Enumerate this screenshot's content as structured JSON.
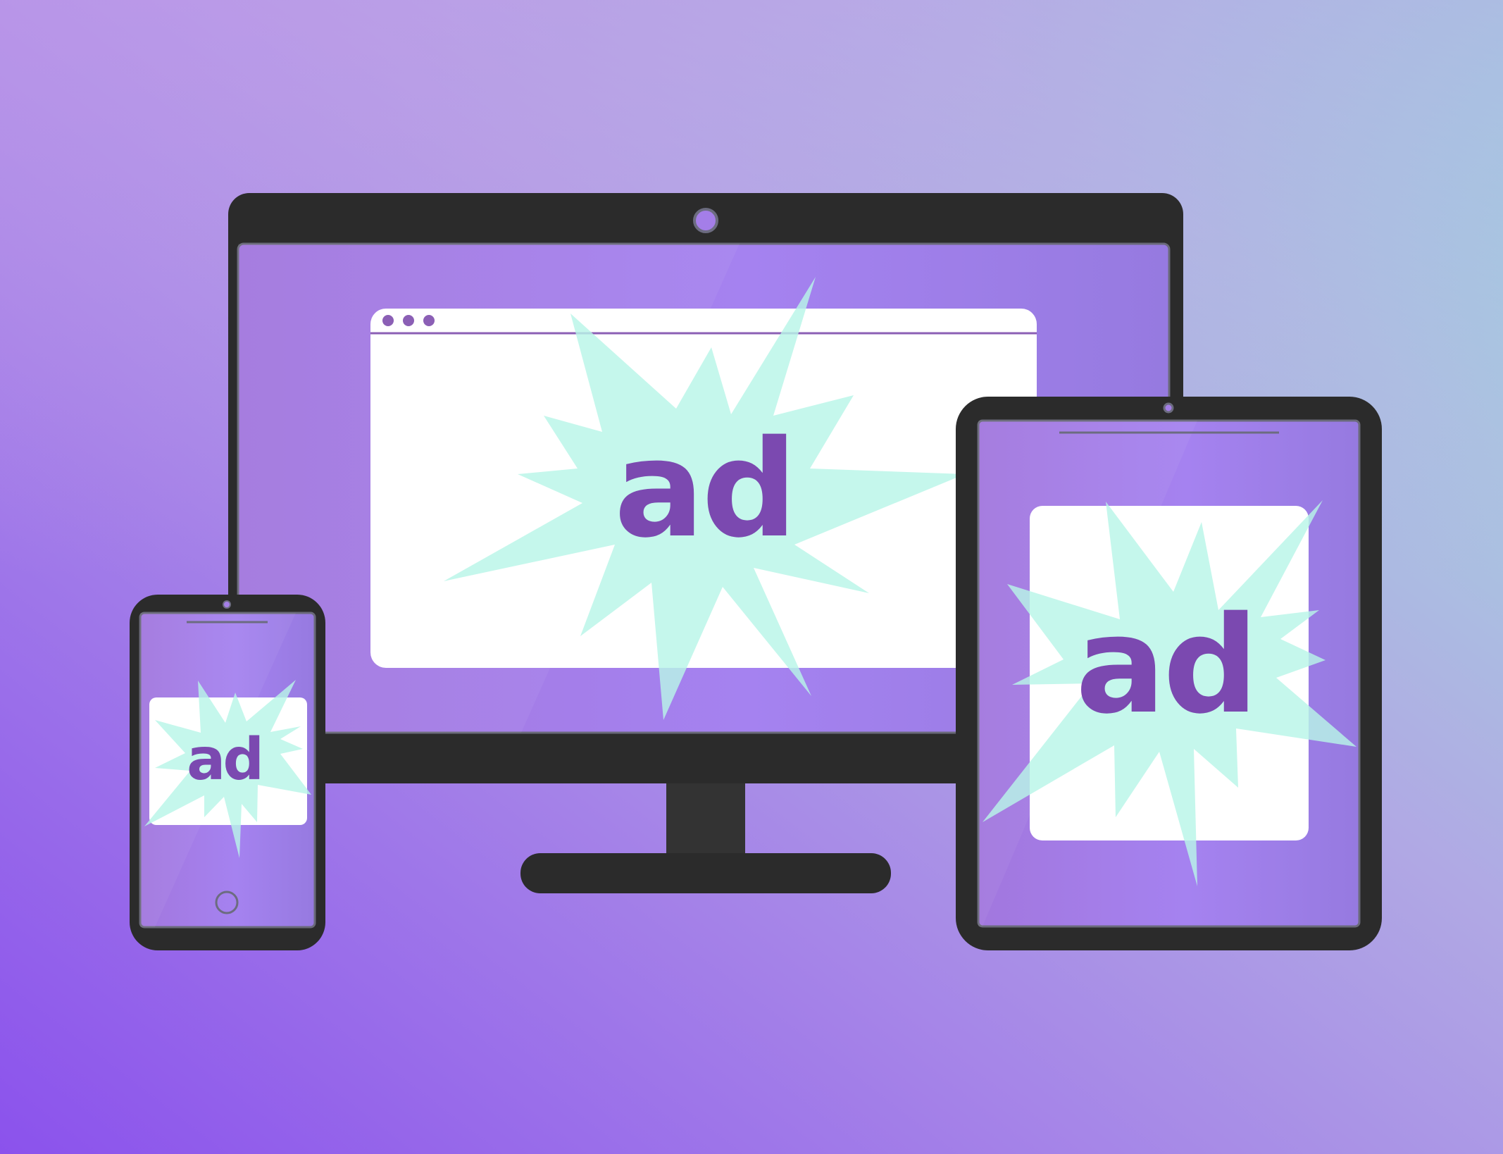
{
  "ads": {
    "monitor_label": "ad",
    "tablet_label": "ad",
    "phone_label": "ad"
  },
  "colors": {
    "background_start": "#8d55ea",
    "background_mid": "#bd94ea",
    "background_end": "#8ff1d9",
    "device_frame": "#2b2b2b",
    "screen": "#a47ee8",
    "ad_window": "#ffffff",
    "burst": "#b8f5e8",
    "ad_text": "#7b49b0",
    "window_dots": "#8b5fb5"
  },
  "icons": {
    "monitor_camera": "camera-icon",
    "tablet_camera": "camera-icon",
    "phone_camera": "camera-icon",
    "phone_home": "home-button-icon",
    "browser_dots": "window-controls-icon",
    "burst": "starburst-icon"
  }
}
